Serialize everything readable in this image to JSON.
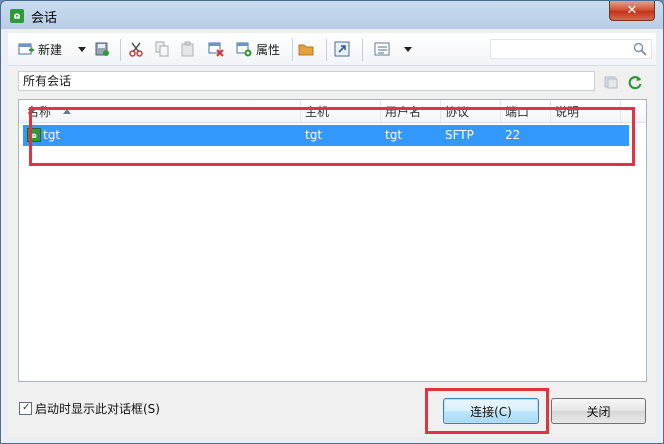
{
  "window": {
    "title": "会话",
    "close_label": "✕",
    "app_icon_glyph": "ɷ"
  },
  "toolbar": {
    "new_label": "新建",
    "properties_label": "属性",
    "search_value": "",
    "search_placeholder": ""
  },
  "path": {
    "value": "所有会话"
  },
  "list": {
    "columns": [
      "名称",
      "主机",
      "用户名",
      "协议",
      "端口",
      "说明"
    ],
    "rows": [
      {
        "name": "tgt",
        "host": "tgt",
        "user": "tgt",
        "protocol": "SFTP",
        "port": "22",
        "description": ""
      }
    ]
  },
  "footer": {
    "show_on_startup_label": "启动时显示此对话框(S)",
    "show_on_startup_checked": true,
    "connect_label": "连接(C)",
    "close_label": "关闭"
  },
  "colors": {
    "selection": "#3399ff",
    "highlight_annotation": "#e0353f",
    "brand_green": "#2f9a3a"
  }
}
